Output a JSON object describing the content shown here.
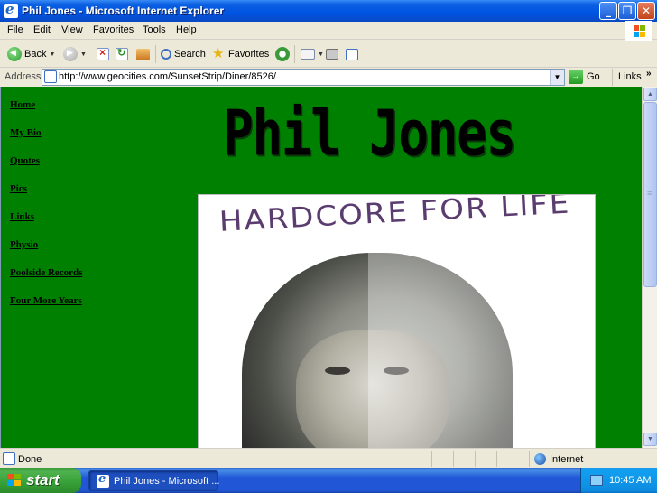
{
  "window": {
    "title": "Phil Jones - Microsoft Internet Explorer",
    "minimize_label": "_",
    "maximize_label": "❐",
    "close_label": "✕"
  },
  "menu": [
    "File",
    "Edit",
    "View",
    "Favorites",
    "Tools",
    "Help"
  ],
  "toolbar": {
    "back_label": "Back",
    "search_label": "Search",
    "favorites_label": "Favorites"
  },
  "address": {
    "label": "Address",
    "url": "http://www.geocities.com/SunsetStrip/Diner/8526/",
    "go_label": "Go",
    "links_label": "Links",
    "links_more": "»"
  },
  "page": {
    "site_title": "Phil Jones",
    "nav": [
      "Home",
      "My Bio",
      "Quotes",
      "Pics",
      "Links",
      "Physio",
      "Poolside Records",
      "Four More Years"
    ],
    "photo_caption": "HARDCORE FOR LIFE",
    "background_color": "#008000"
  },
  "status": {
    "text": "Done",
    "zone": "Internet"
  },
  "taskbar": {
    "start_label": "start",
    "task_label": "Phil Jones - Microsoft ...",
    "clock": "10:45 AM"
  }
}
